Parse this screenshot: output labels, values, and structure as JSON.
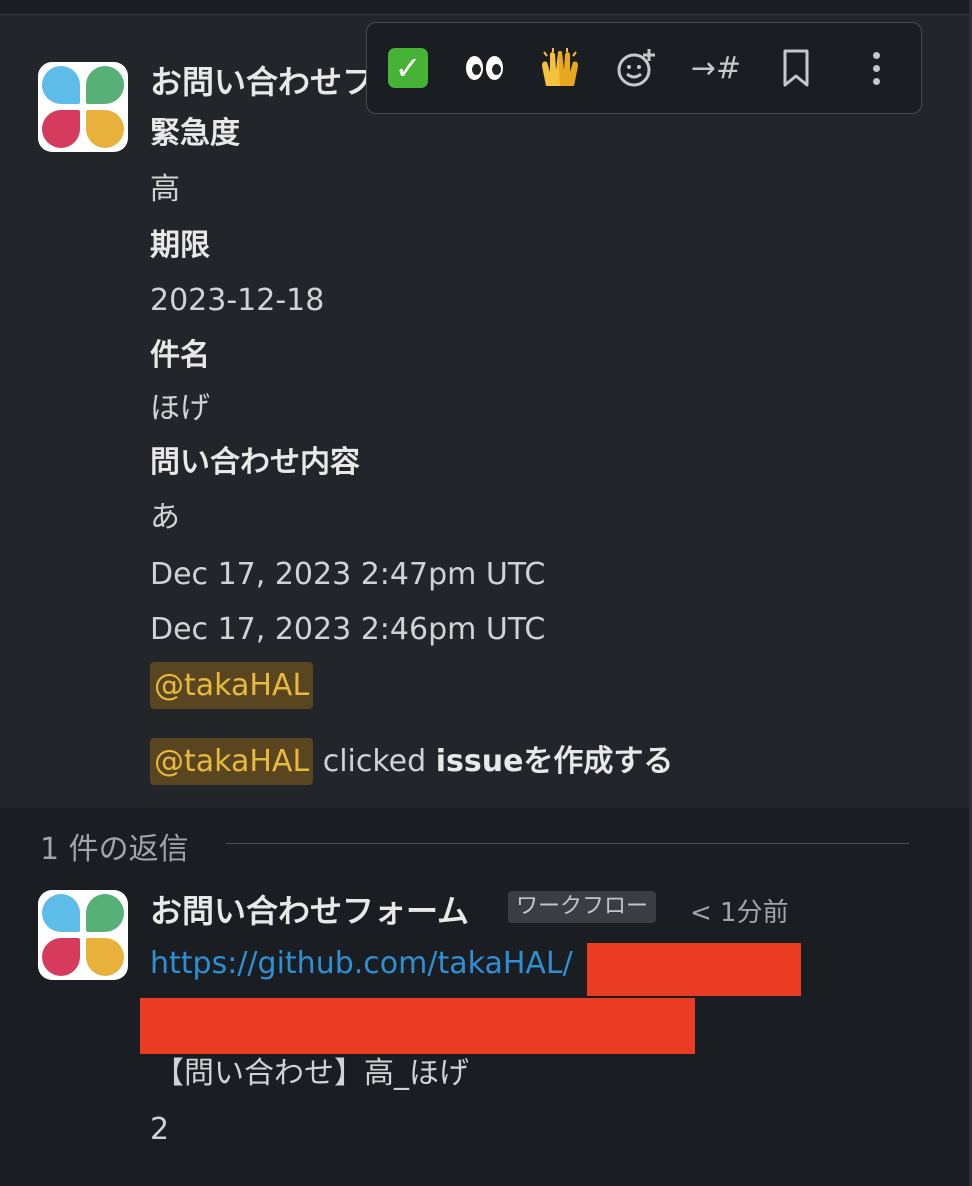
{
  "message": {
    "sender": "お問い合わせフォーム",
    "sender_visible": "お問い合わせフ",
    "fields": [
      {
        "label": "緊急度",
        "value": "高"
      },
      {
        "label": "期限",
        "value": "2023-12-18"
      },
      {
        "label": "件名",
        "value": "ほげ"
      },
      {
        "label": "問い合わせ内容",
        "value": "あ"
      }
    ],
    "timestamps": [
      "Dec 17, 2023 2:47pm UTC",
      "Dec 17, 2023 2:46pm UTC"
    ],
    "mention": "@takaHAL",
    "clicked_mention": "@takaHAL",
    "clicked_text": "clicked",
    "clicked_action": "issueを作成する"
  },
  "toolbar": {
    "items": [
      "white-check-mark-icon",
      "eyes-icon",
      "raised-hands-icon",
      "add-reaction-icon",
      "forward-to-channel-icon",
      "bookmark-icon",
      "more-actions-icon"
    ],
    "forward_label": "→#"
  },
  "thread": {
    "reply_count_label": "1 件の返信",
    "reply": {
      "sender": "お問い合わせフォーム",
      "badge": "ワークフロー",
      "time": "< 1分前",
      "link": "https://github.com/takaHAL/",
      "title": "【問い合わせ】高_ほげ",
      "number": "2"
    }
  },
  "colors": {
    "background": "#1a1d21",
    "message_hover": "#222529",
    "mention_bg": "#5a4521",
    "mention_text": "#e7b93d",
    "link": "#2f8fd3",
    "redaction": "#ea3c23"
  }
}
